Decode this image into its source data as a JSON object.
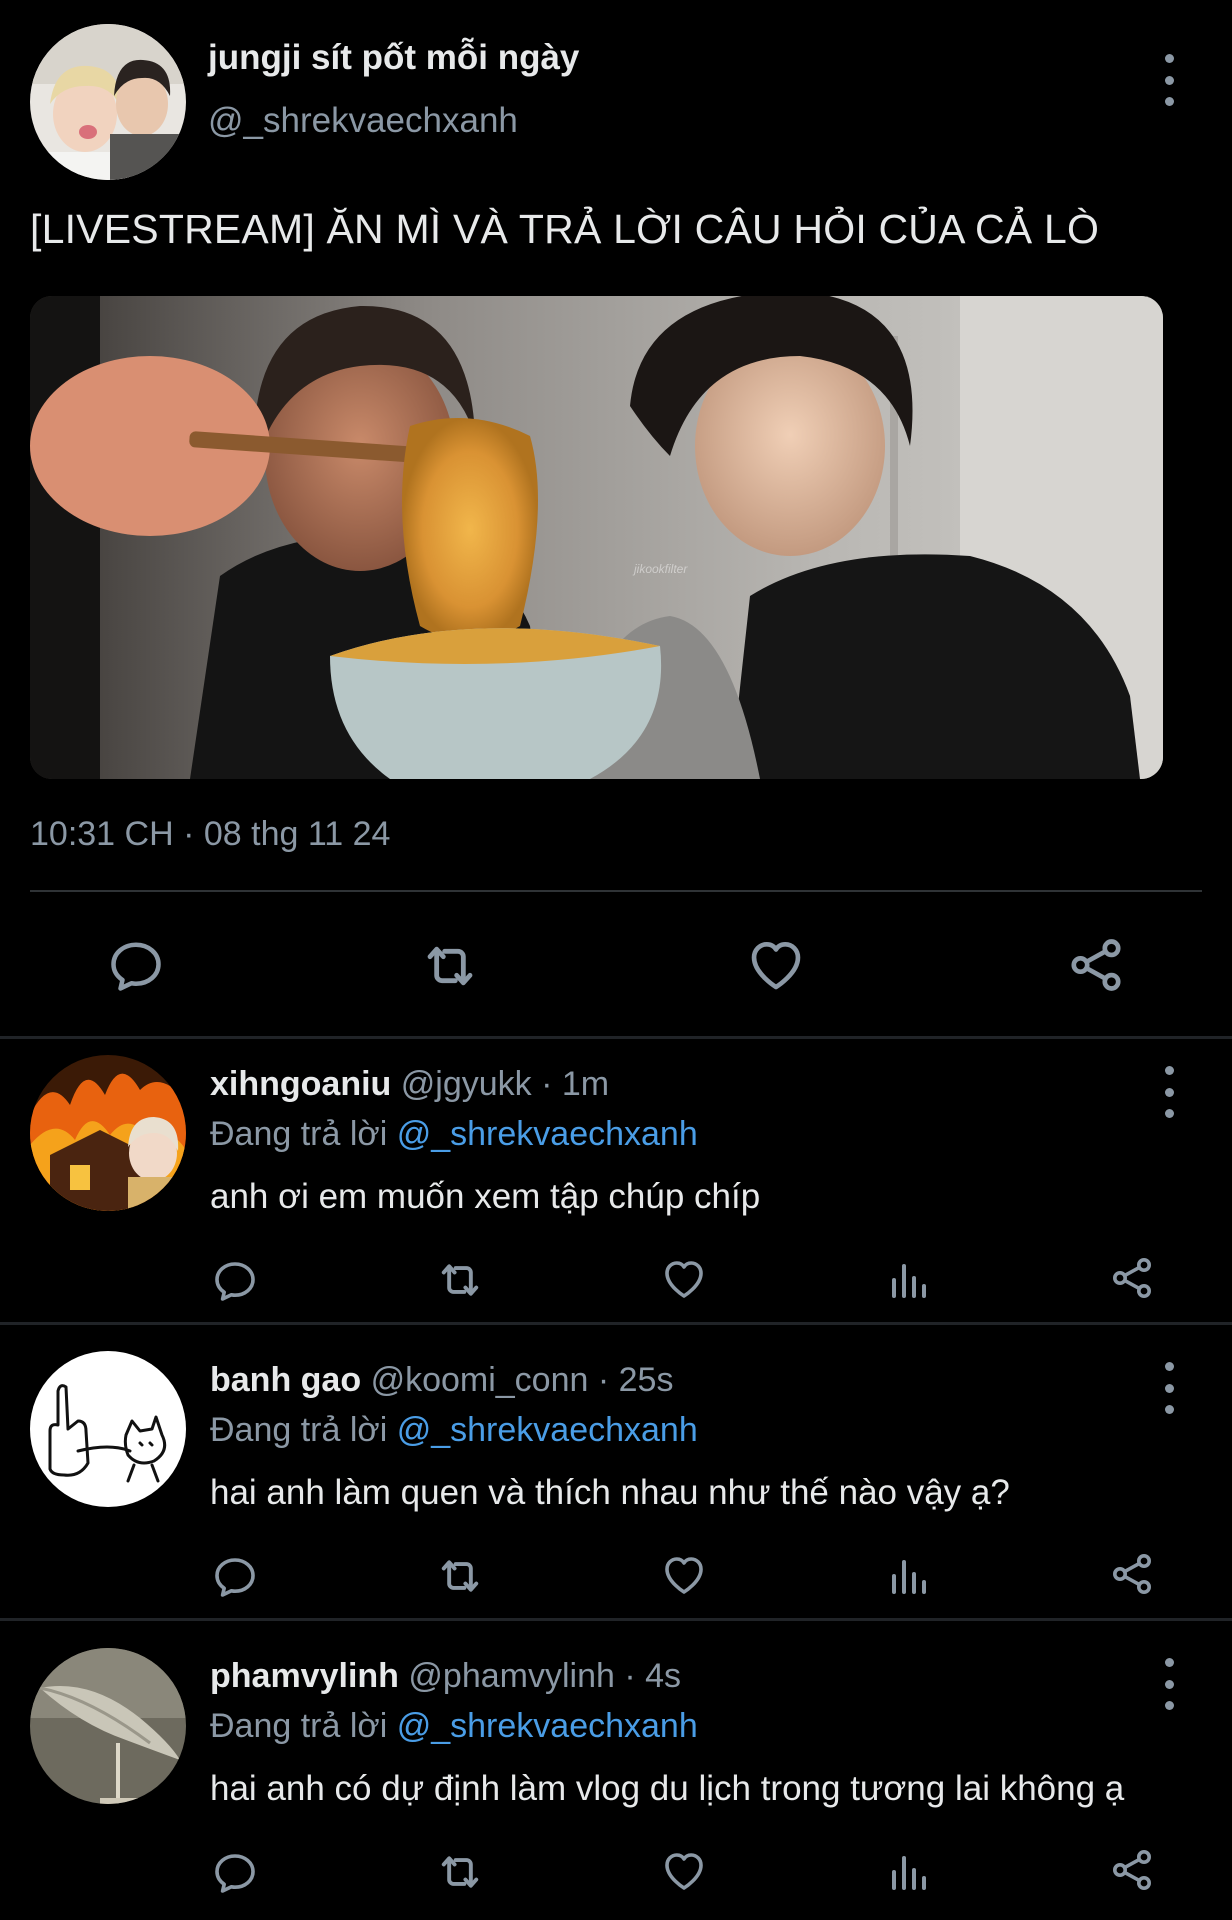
{
  "tweet": {
    "display_name": "jungji sít pốt mỗi ngày",
    "handle": "@_shrekvaechxanh",
    "text": "[LIVESTREAM] ĂN MÌ VÀ TRẢ LỜI CÂU HỎI CỦA CẢ LÒ",
    "timestamp": "10:31 CH · 08 thg 11 24",
    "media_watermark": "jikookfilter"
  },
  "replying_to_prefix": "Đang trả lời",
  "replies": [
    {
      "name": "xihngoaniu",
      "handle": "@jgyukk",
      "time": "· 1m",
      "reply_to": "@_shrekvaechxanh",
      "text": "anh ơi em muốn xem tập chúp chíp"
    },
    {
      "name": "banh gao",
      "handle": "@koomi_conn",
      "time": "· 25s",
      "reply_to": "@_shrekvaechxanh",
      "text": "hai anh làm quen và thích nhau như thế nào vậy ạ?"
    },
    {
      "name": "phamvylinh",
      "handle": "@phamvylinh",
      "time": "· 4s",
      "reply_to": "@_shrekvaechxanh",
      "text": "hai anh có dự định làm vlog du lịch trong tương lai không ạ"
    }
  ],
  "icons": [
    "more-vertical-icon",
    "reply-icon",
    "retweet-icon",
    "like-icon",
    "share-icon",
    "views-icon"
  ],
  "colors": {
    "background": "#000000",
    "text": "#e7e9ea",
    "muted": "#8b98a5",
    "link": "#4a9de6",
    "divider": "#202327"
  }
}
